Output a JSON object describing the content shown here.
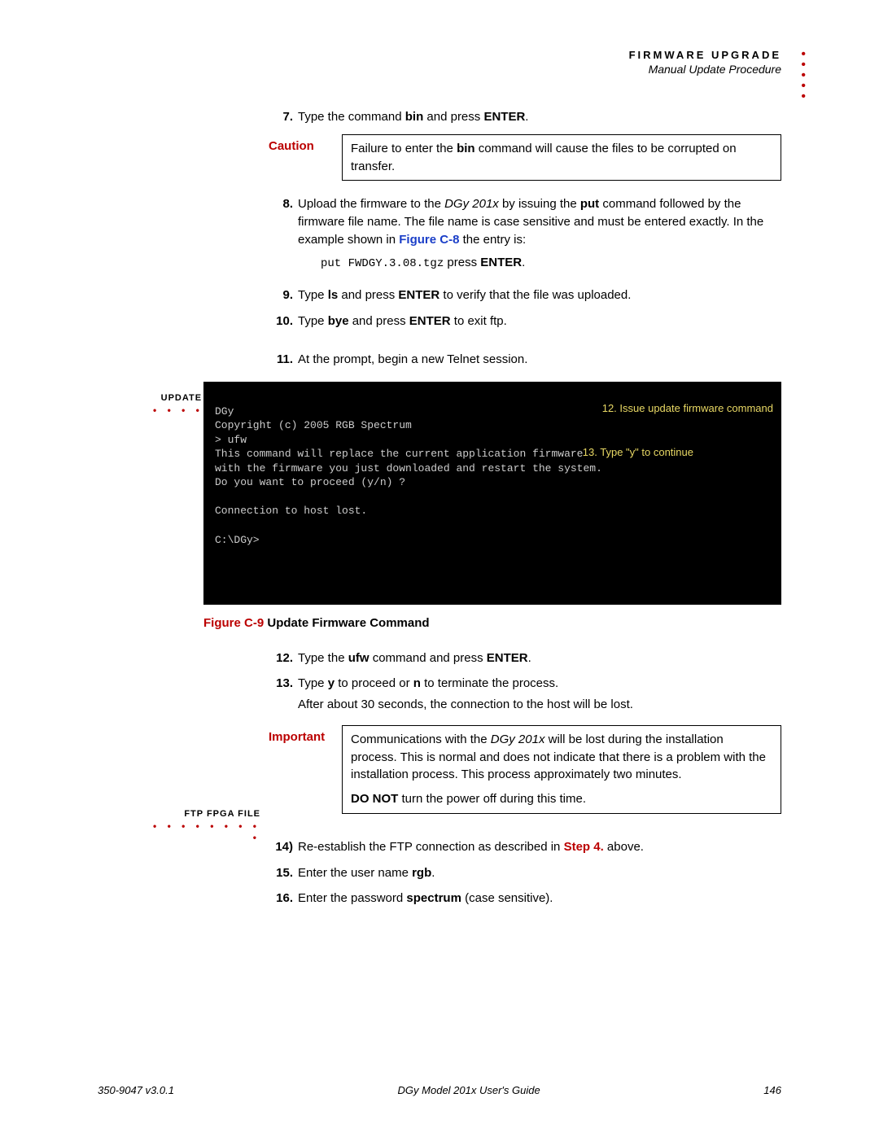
{
  "header": {
    "title": "FIRMWARE UPGRADE",
    "subtitle": "Manual Update Procedure"
  },
  "side_labels": {
    "update_firmware": "UPDATE FIRMWARE",
    "ftp_fpga": "FTP FPGA FILE"
  },
  "steps": {
    "s7_num": "7.",
    "s7_a": "Type the command ",
    "s7_b": "bin",
    "s7_c": " and press ",
    "s7_d": "ENTER",
    "s7_e": ".",
    "s8_num": "8.",
    "s8_a": "Upload the firmware to the ",
    "s8_b": "DGy 201x",
    "s8_c": " by issuing the ",
    "s8_d": "put",
    "s8_e": " command followed by the firmware file name. The file name is case sensitive and must be entered exactly. In the example shown in ",
    "s8_f": "Figure C-8",
    "s8_g": " the entry is:",
    "s8_cmd_a": "put FWDGY.3.08.tgz",
    "s8_cmd_b": " press ",
    "s8_cmd_c": "ENTER",
    "s8_cmd_d": ".",
    "s9_num": "9.",
    "s9_a": "Type ",
    "s9_b": "ls",
    "s9_c": " and press ",
    "s9_d": "ENTER",
    "s9_e": " to verify that the file was uploaded.",
    "s10_num": "10.",
    "s10_a": "Type ",
    "s10_b": "bye",
    "s10_c": " and press ",
    "s10_d": "ENTER",
    "s10_e": " to exit ftp.",
    "s11_num": "11.",
    "s11_a": "At the prompt, begin a new Telnet session.",
    "s12_num": "12.",
    "s12_a": "Type the ",
    "s12_b": "ufw",
    "s12_c": " command and press ",
    "s12_d": "ENTER",
    "s12_e": ".",
    "s13_num": "13.",
    "s13_a": "Type ",
    "s13_b": "y",
    "s13_c": " to proceed or ",
    "s13_d": "n",
    "s13_e": " to terminate the process.",
    "s13_after": "After about 30 seconds, the connection to the host will be lost.",
    "s14_num": "14)",
    "s14_a": "Re-establish the FTP connection as described in ",
    "s14_b": "Step 4.",
    "s14_c": " above.",
    "s15_num": "15.",
    "s15_a": "Enter the user name ",
    "s15_b": "rgb",
    "s15_c": ".",
    "s16_num": "16.",
    "s16_a": "Enter the password ",
    "s16_b": "spectrum",
    "s16_c": " (case sensitive)."
  },
  "caution": {
    "label": "Caution",
    "text_a": "Failure to enter the ",
    "text_b": "bin",
    "text_c": " command will cause the files to be corrupted on transfer."
  },
  "important": {
    "label": "Important",
    "p1_a": "Communications with the ",
    "p1_b": "DGy 201x",
    "p1_c": " will be lost during the installation process. This is normal and does not indicate that there is a problem with the installation process. This process approximately two minutes.",
    "p2_a": "DO NOT",
    "p2_b": " turn the power off during this time."
  },
  "terminal": {
    "line1": "DGy",
    "line2": "Copyright (c) 2005 RGB Spectrum",
    "line3": "> ufw",
    "line4": "This command will replace the current application firmware",
    "line5": "with the firmware you just downloaded and restart the system.",
    "line6": "Do you want to proceed (y/n) ?",
    "blank": "",
    "line7": "Connection to host lost.",
    "line8": "C:\\DGy>",
    "annot1": "12. Issue update firmware command",
    "annot2": "13. Type \"y\" to continue"
  },
  "figure": {
    "label": "Figure C-9",
    "title": "  Update Firmware Command"
  },
  "footer": {
    "left": "350-9047 v3.0.1",
    "center": "DGy Model 201x User's Guide",
    "right": "146"
  }
}
